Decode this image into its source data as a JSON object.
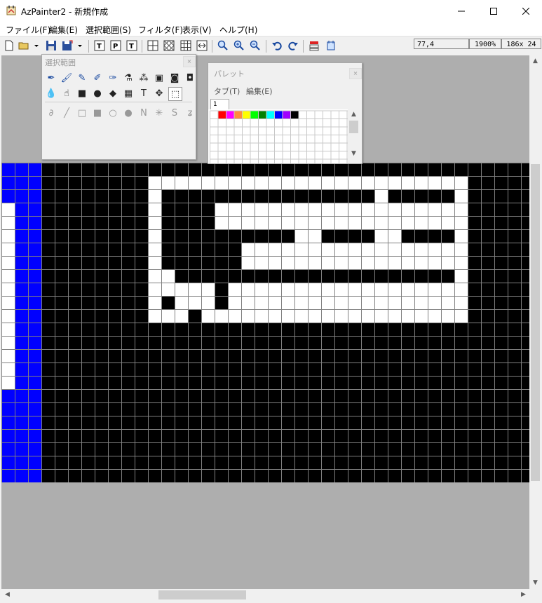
{
  "window": {
    "title": "AzPainter2 - 新規作成",
    "minimize_glyph": "─",
    "maximize_glyph": "☐",
    "close_glyph": "✕"
  },
  "menu": [
    {
      "label": "ファイル(F)",
      "name": "menu-file"
    },
    {
      "label": "編集(E)",
      "name": "menu-edit"
    },
    {
      "label": "選択範囲(S)",
      "name": "menu-select"
    },
    {
      "label": "フィルタ(F)",
      "name": "menu-filter"
    },
    {
      "label": "表示(V)",
      "name": "menu-view"
    },
    {
      "label": "ヘルプ(H)",
      "name": "menu-help"
    }
  ],
  "toolbar": {
    "icons": [
      "new-file-icon",
      "open-folder-icon",
      "open-dropdown-icon",
      "save-icon",
      "save-as-icon",
      "save-dropdown-icon",
      "text-layer-icon",
      "paste-text-icon",
      "text-tool-icon",
      "grid-toggle-icon",
      "checker-icon",
      "grid-icon",
      "fit-width-icon",
      "zoom-fit-icon",
      "zoom-in-icon",
      "zoom-out-icon",
      "undo-icon",
      "redo-icon",
      "layer-dialog-icon",
      "options-dialog-icon"
    ],
    "status": {
      "cursor_pos": "77,4",
      "zoom": "1900%",
      "image_size": "186x  24"
    }
  },
  "tool_panel": {
    "title": "選択範囲",
    "close_glyph": "×",
    "row1": [
      "pen-icon",
      "brush-icon",
      "airbrush-icon",
      "pencil-dot-icon",
      "calligraphy-icon",
      "dropper-icon",
      "scatter-icon",
      "stamp-icon",
      "blur-icon",
      "sharpen-icon"
    ],
    "row2": [
      "water-drop-icon",
      "smudge-icon",
      "fill-rect-icon",
      "fill-ellipse-icon",
      "bucket-icon",
      "gradient-icon",
      "text-icon",
      "move-icon",
      "select-icon"
    ],
    "row3": [
      "lasso-sub-icon",
      "line-sub-icon",
      "rect-outline-sub-icon",
      "rect-fill-sub-icon",
      "circle-outline-sub-icon",
      "circle-fill-sub-icon",
      "polyline-sub-icon",
      "star-sub-icon",
      "curve-sub-icon",
      "freehand-sub-icon"
    ]
  },
  "palette_panel": {
    "title": "パレット",
    "close_glyph": "×",
    "menu_tab": "タブ(T)",
    "menu_edit": "編集(E)",
    "tab_label": "1",
    "colors": [
      "#ff0000",
      "#ff00ff",
      "#ff8c3c",
      "#ffff00",
      "#00ff00",
      "#008000",
      "#00ffff",
      "#0000ff",
      "#a000ff",
      "#000000"
    ]
  },
  "colors": {
    "canvas_black": "#000000",
    "canvas_white": "#ffffff",
    "canvas_blue": "#0000ff",
    "workspace_gray": "#aeaeae",
    "grid_line": "#808080"
  }
}
